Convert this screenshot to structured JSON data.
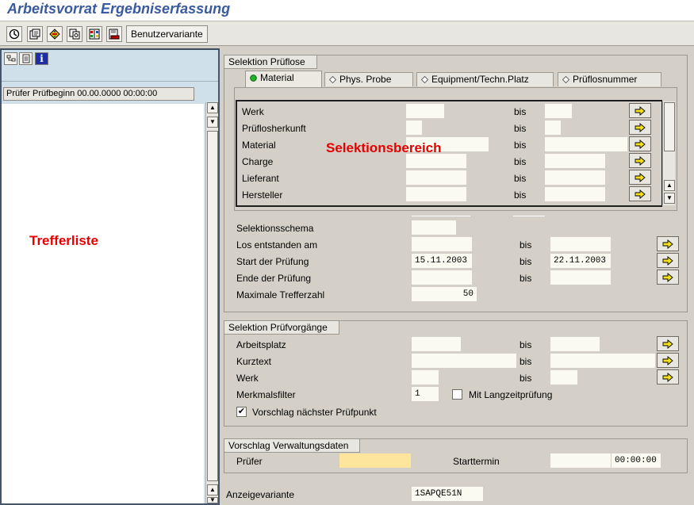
{
  "window": {
    "title": "Arbeitsvorrat Ergebniserfassung"
  },
  "toolbar": {
    "icons": [
      "execute-icon",
      "variant-icon",
      "multi-select-icon",
      "copy-icon",
      "layout-icon",
      "save-icon"
    ],
    "benutzervariante_label": "Benutzervariante"
  },
  "left": {
    "tool_icons": [
      "tree-icon",
      "list-icon",
      "info-icon"
    ],
    "column_header": "Prüfer Prüfbeginn 00.00.0000 00:00:00",
    "annotation": "Trefferliste"
  },
  "selektion_prueflose": {
    "title": "Selektion  Prüflose",
    "tabs": [
      {
        "label": "Material",
        "active": true
      },
      {
        "label": "Phys. Probe",
        "active": false
      },
      {
        "label": "Equipment/Techn.Platz",
        "active": false
      },
      {
        "label": "Prüflosnummer",
        "active": false
      }
    ],
    "annotation": "Selektionsbereich",
    "tab_rows": [
      {
        "label": "Werk",
        "from": "",
        "to_label": "bis",
        "to": ""
      },
      {
        "label": "Prüflosherkunft",
        "from": "",
        "to_label": "bis",
        "to": ""
      },
      {
        "label": "Material",
        "from": "",
        "to_label": "bis",
        "to": ""
      },
      {
        "label": "Charge",
        "from": "",
        "to_label": "bis",
        "to": ""
      },
      {
        "label": "Lieferant",
        "from": "",
        "to_label": "bis",
        "to": ""
      },
      {
        "label": "Hersteller",
        "from": "",
        "to_label": "bis",
        "to": ""
      }
    ],
    "selektionsschema_label": "Selektionsschema",
    "selektionsschema_value": "",
    "rows": [
      {
        "label": "Los entstanden am",
        "from": "",
        "to_label": "bis",
        "to": ""
      },
      {
        "label": "Start der Prüfung",
        "from": "15.11.2003",
        "to_label": "bis",
        "to": "22.11.2003"
      },
      {
        "label": "Ende der Prüfung",
        "from": "",
        "to_label": "bis",
        "to": ""
      }
    ],
    "max_treffer_label": "Maximale Trefferzahl",
    "max_treffer_value": "50"
  },
  "selektion_pruefvorgaenge": {
    "title": "Selektion Prüfvorgänge",
    "rows": [
      {
        "label": "Arbeitsplatz",
        "from": "",
        "to_label": "bis",
        "to": ""
      },
      {
        "label": "Kurztext",
        "from": "",
        "to_label": "bis",
        "to": ""
      },
      {
        "label": "Werk",
        "from": "",
        "to_label": "bis",
        "to": ""
      }
    ],
    "merkmalsfilter_label": "Merkmalsfilter",
    "merkmalsfilter_value": "1",
    "langzeit_label": "Mit Langzeitprüfung",
    "langzeit_checked": false,
    "vorschlag_label": "Vorschlag nächster Prüfpunkt",
    "vorschlag_checked": true
  },
  "vorschlag_verwaltung": {
    "title": "Vorschlag Verwaltungsdaten",
    "pruefer_label": "Prüfer",
    "pruefer_value": "",
    "starttermin_label": "Starttermin",
    "starttermin_date": "",
    "starttermin_time": "00:00:00"
  },
  "anzeigevariante": {
    "label": "Anzeigevariante",
    "value": "1SAPQE51N"
  },
  "colors": {
    "title": "#3a5aa0",
    "annotation": "#e60000",
    "left_panel": "#cfe0ea",
    "required_field": "#fde69b"
  }
}
